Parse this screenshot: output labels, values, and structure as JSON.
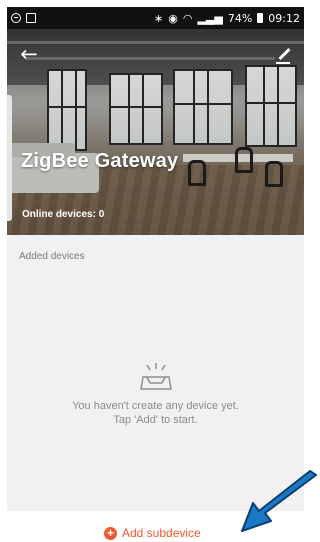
{
  "status_bar": {
    "icons_left": [
      "minus-circle-icon",
      "checkbox-icon"
    ],
    "icons_right": [
      "bluetooth-icon",
      "alarm-icon",
      "wifi-icon",
      "signal-icon",
      "battery-icon"
    ],
    "battery": "74%",
    "time": "09:12"
  },
  "header": {
    "title": "ZigBee Gateway",
    "online_devices": "Online devices: 0",
    "back_icon": "back-arrow-icon",
    "edit_icon": "pencil-icon"
  },
  "content": {
    "section_label": "Added devices",
    "empty_icon": "empty-tray-icon",
    "empty_line1": "You haven't create any device yet.",
    "empty_line2": "Tap 'Add' to start."
  },
  "actions": {
    "add_label": "Add subdevice",
    "add_icon": "plus-circle-icon"
  },
  "colors": {
    "accent": "#ef5a2f",
    "status_bar": "#111111",
    "content_bg": "#f1f1f3",
    "arrow_annotation": "#1b78c4"
  }
}
